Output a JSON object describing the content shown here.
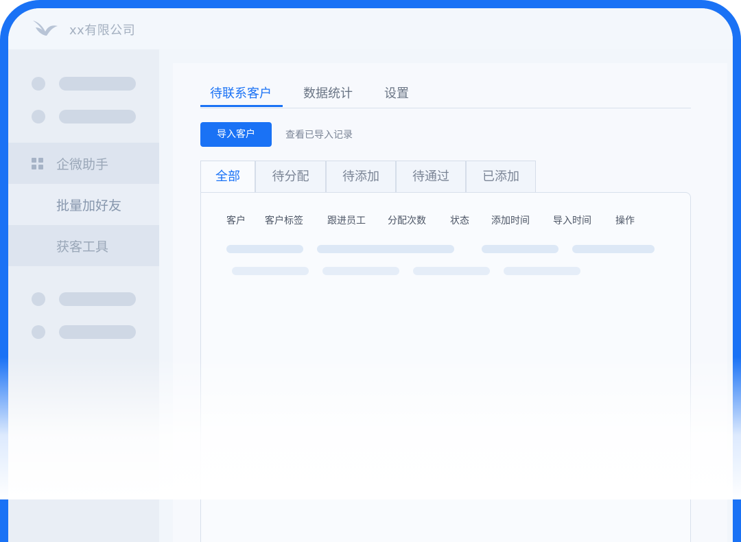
{
  "app": {
    "title": "xx有限公司",
    "accent_color": "#1a72f5",
    "logo_icon": "swallow-logo-icon"
  },
  "sidebar": {
    "items": [
      {
        "label": "企微助手",
        "icon": "grid-icon"
      },
      {
        "label": "批量加好友",
        "selected": true
      },
      {
        "label": "获客工具"
      }
    ]
  },
  "main_tabs": [
    {
      "label": "待联系客户",
      "active": true
    },
    {
      "label": "数据统计"
    },
    {
      "label": "设置"
    }
  ],
  "toolbar": {
    "import_button": "导入客户",
    "records_link": "查看已导入记录"
  },
  "status_tabs": [
    {
      "label": "全部",
      "active": true
    },
    {
      "label": "待分配"
    },
    {
      "label": "待添加"
    },
    {
      "label": "待通过"
    },
    {
      "label": "已添加"
    }
  ],
  "table": {
    "columns": [
      "客户",
      "客户标签",
      "跟进员工",
      "分配次数",
      "状态",
      "添加时间",
      "导入时间",
      "操作"
    ]
  }
}
